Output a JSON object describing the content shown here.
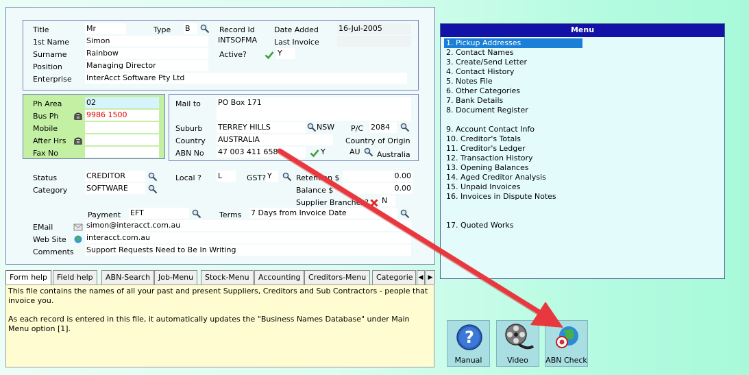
{
  "contact": {
    "title_label": "Title",
    "title_value": "Mr",
    "first_name_label": "1st Name",
    "first_name_value": "Simon",
    "surname_label": "Surname",
    "surname_value": "Rainbow",
    "position_label": "Position",
    "position_value": "Managing Director",
    "enterprise_label": "Enterprise",
    "enterprise_value": "InterAcct Software Pty Ltd",
    "type_label": "Type",
    "type_value": "B",
    "record_id_label": "Record Id",
    "record_id_value": "INTSOFMA",
    "active_label": "Active?",
    "active_value": "Y",
    "date_added_label": "Date Added",
    "date_added_value": "16-Jul-2005",
    "last_invoice_label": "Last Invoice",
    "last_invoice_value": ""
  },
  "phones": {
    "ph_area_label": "Ph Area",
    "ph_area_value": "02",
    "bus_ph_label": "Bus Ph",
    "bus_ph_value": "9986 1500",
    "mobile_label": "Mobile",
    "mobile_value": "",
    "after_hrs_label": "After Hrs",
    "after_hrs_value": "",
    "fax_label": "Fax No",
    "fax_value": ""
  },
  "address": {
    "mail_to_label": "Mail to",
    "mail_to_value": "PO Box 171",
    "suburb_label": "Suburb",
    "suburb_value": "TERREY HILLS",
    "state_value": "NSW",
    "pc_label": "P/C",
    "pc_value": "2084",
    "country_label": "Country",
    "country_value": "AUSTRALIA",
    "country_origin_label": "Country of Origin",
    "abn_label": "ABN No",
    "abn_value": "47 003 411 658",
    "abn_check_value": "Y",
    "origin_code": "AU",
    "origin_value": "Australia"
  },
  "details": {
    "status_label": "Status",
    "status_value": "CREDITOR",
    "category_label": "Category",
    "category_value": "SOFTWARE",
    "local_label": "Local ?",
    "local_value": "L",
    "gst_label": "GST?",
    "gst_value": "Y",
    "retention_label": "Retention $",
    "retention_value": "0.00",
    "balance_label": "Balance $",
    "balance_value": "0.00",
    "supplier_branch_label": "Supplier Branches?",
    "supplier_branch_value": "N",
    "payment_label": "Payment",
    "payment_value": "EFT",
    "terms_label": "Terms",
    "terms_value": "7 Days from Invoice Date",
    "email_label": "EMail",
    "email_value": "simon@interacct.com.au",
    "website_label": "Web Site",
    "website_value": "interacct.com.au",
    "comments_label": "Comments",
    "comments_value": "Support Requests Need to Be In Writing"
  },
  "tabs": [
    "Form help",
    "Field help",
    "ABN-Search",
    "Job-Menu",
    "Stock-Menu",
    "Accounting",
    "Creditors-Menu",
    "Categorie"
  ],
  "help_text": {
    "para1": "This file contains the names of all your past and present Suppliers, Creditors and Sub Contractors - people that invoice you.",
    "para2": "As each record is entered in this file, it automatically updates the \"Business Names Database\" under Main Menu option [1]."
  },
  "menu": {
    "title": "Menu",
    "items": [
      "1. Pickup Addresses",
      "2. Contact Names",
      "3. Create/Send Letter",
      "4. Contact History",
      "5. Notes File",
      "6. Other Categories",
      "7. Bank Details",
      "8. Document Register",
      "9. Account Contact Info",
      "10. Creditor's Totals",
      "11. Creditor's Ledger",
      "12. Transaction History",
      "13. Opening Balances",
      "14. Aged Creditor Analysis",
      "15. Unpaid Invoices",
      "16. Invoices in Dispute Notes",
      "17. Quoted Works"
    ]
  },
  "buttons": {
    "manual": "Manual",
    "video": "Video",
    "abn_check": "ABN Check"
  },
  "colors": {
    "menu_header": "#1212a6",
    "menu_selected": "#1a7fd6",
    "arrow": "#e8383d",
    "red_text": "#e00000"
  },
  "icons": [
    "search-icon",
    "check-icon",
    "phone-icon",
    "globe-icon",
    "email-icon",
    "x-icon",
    "help-icon",
    "film-reel-icon",
    "globe-check-icon"
  ]
}
